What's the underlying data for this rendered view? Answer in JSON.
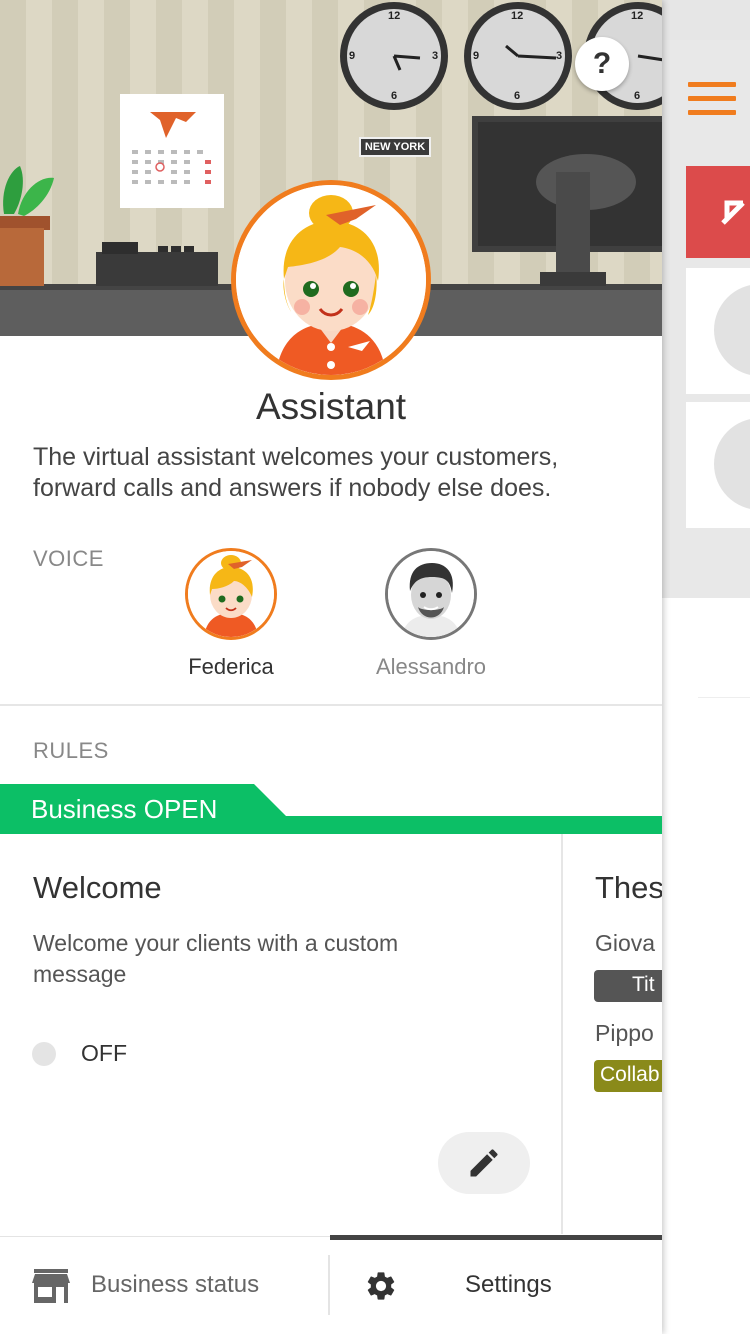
{
  "header": {
    "help_glyph": "?",
    "city_label": "NEW YORK",
    "clock_numbers": [
      "12",
      "3",
      "6",
      "9"
    ]
  },
  "assistant": {
    "title": "Assistant",
    "description": "The virtual assistant welcomes your customers, forward calls and answers if nobody else does."
  },
  "voice": {
    "label": "VOICE",
    "options": [
      {
        "name": "Federica",
        "selected": true
      },
      {
        "name": "Alessandro",
        "selected": false
      }
    ]
  },
  "rules": {
    "label": "RULES",
    "banner": "Business OPEN",
    "welcome_card": {
      "title": "Welcome",
      "description": "Welcome your clients with a custom message",
      "toggle_state": "OFF",
      "edit_icon": "pencil-icon"
    },
    "second_card": {
      "title_partial": "Thes",
      "people": [
        {
          "name_partial": "Giova",
          "tag_partial": "Tit",
          "tag_color": "#555555"
        },
        {
          "name_partial": "Pippo",
          "tag_partial": "Collab",
          "tag_color": "#8a8a1a"
        }
      ]
    }
  },
  "bottom_nav": {
    "status_label": "Business status",
    "status_icon": "store-icon",
    "settings_label": "Settings",
    "settings_icon": "gear-icon",
    "active_tab": "Settings"
  },
  "colors": {
    "accent": "#f07c1e",
    "open_green": "#0cbf66",
    "alert_red": "#dc4b4b"
  }
}
